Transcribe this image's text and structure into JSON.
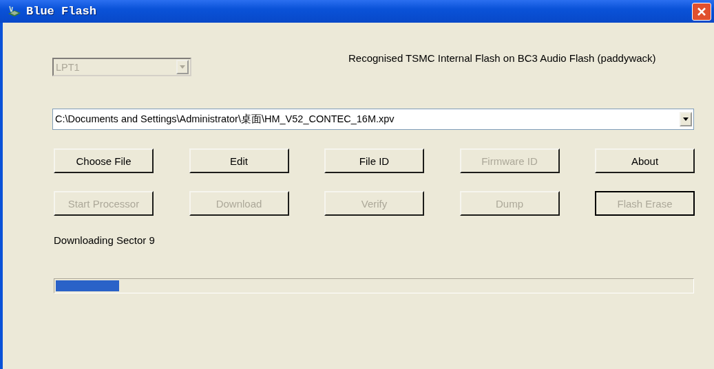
{
  "window": {
    "title": "Blue Flash"
  },
  "port": {
    "value": "LPT1",
    "disabled": true
  },
  "device_status": "Recognised TSMC Internal Flash on BC3 Audio Flash (paddywack)",
  "file": {
    "value": "C:\\Documents and Settings\\Administrator\\桌面\\HM_V52_CONTEC_16M.xpv",
    "disabled": false
  },
  "buttons": [
    {
      "label": "Choose File",
      "disabled": false,
      "default": false
    },
    {
      "label": "Edit",
      "disabled": false,
      "default": false
    },
    {
      "label": "File ID",
      "disabled": false,
      "default": false
    },
    {
      "label": "Firmware ID",
      "disabled": true,
      "default": false
    },
    {
      "label": "About",
      "disabled": false,
      "default": false
    },
    {
      "label": "Start Processor",
      "disabled": true,
      "default": false
    },
    {
      "label": "Download",
      "disabled": true,
      "default": false
    },
    {
      "label": "Verify",
      "disabled": true,
      "default": false
    },
    {
      "label": "Dump",
      "disabled": true,
      "default": false
    },
    {
      "label": "Flash Erase",
      "disabled": true,
      "default": true
    }
  ],
  "status": "Downloading Sector 9",
  "progress": {
    "level": 0.1
  }
}
